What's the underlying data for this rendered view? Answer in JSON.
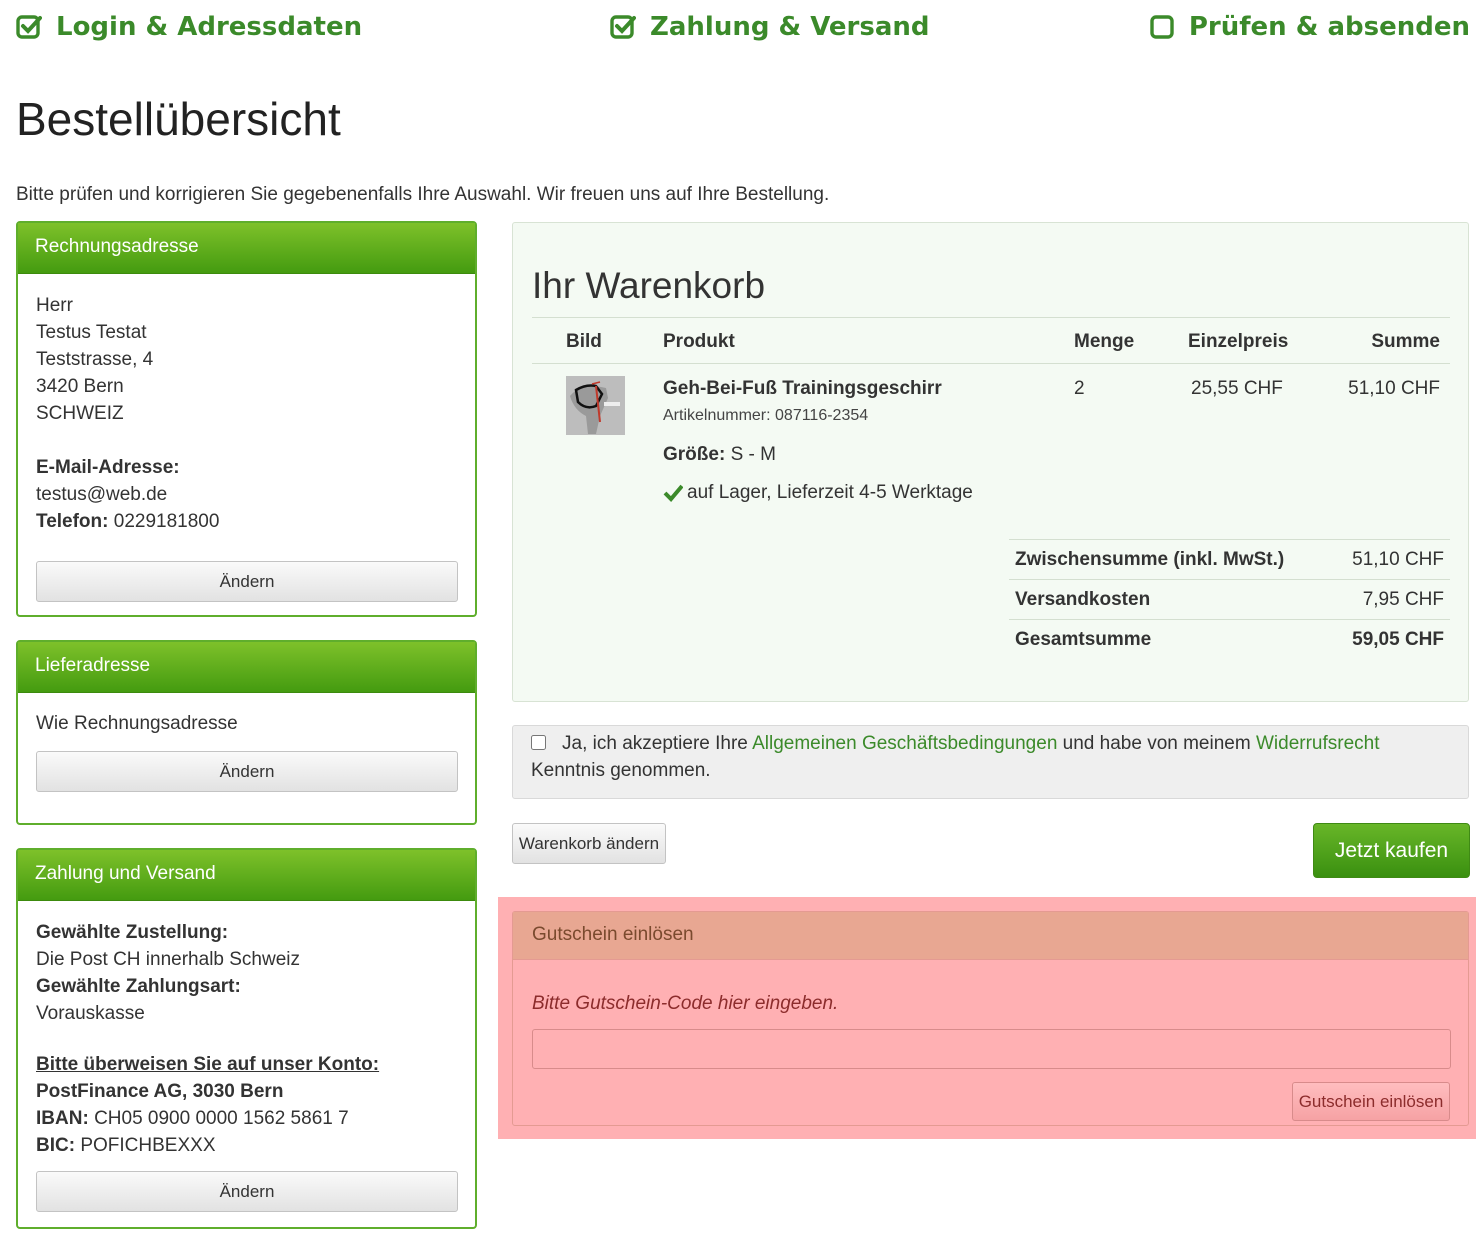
{
  "steps": [
    {
      "label": "Login & Adressdaten",
      "state": "done"
    },
    {
      "label": "Zahlung & Versand",
      "state": "done"
    },
    {
      "label": "Prüfen & absenden",
      "state": "open"
    }
  ],
  "page_title": "Bestellübersicht",
  "intro": "Bitte prüfen und korrigieren Sie gegebenenfalls Ihre Auswahl. Wir freuen uns auf Ihre Bestellung.",
  "billing": {
    "title": "Rechnungsadresse",
    "salutation": "Herr",
    "name": "Testus Testat",
    "street": "Teststrasse, 4",
    "city": "3420 Bern",
    "country": "SCHWEIZ",
    "email_label": "E-Mail-Adresse:",
    "email": "testus@web.de",
    "phone_label": "Telefon:",
    "phone": "0229181800",
    "change_label": "Ändern"
  },
  "shipping": {
    "title": "Lieferadresse",
    "text": "Wie Rechnungsadresse",
    "change_label": "Ändern"
  },
  "payment": {
    "title": "Zahlung und Versand",
    "delivery_label": "Gewählte Zustellung:",
    "delivery": "Die Post CH innerhalb Schweiz",
    "method_label": "Gewählte Zahlungsart:",
    "method": "Vorauskasse",
    "transfer_label": "Bitte überweisen Sie auf unser Konto:",
    "bank": "PostFinance AG, 3030 Bern",
    "iban_label": "IBAN:",
    "iban": "CH05 0900 0000 1562 5861 7",
    "bic_label": "BIC:",
    "bic": "POFICHBEXXX",
    "change_label": "Ändern"
  },
  "cart": {
    "title": "Ihr Warenkorb",
    "headers": {
      "image": "Bild",
      "product": "Produkt",
      "qty": "Menge",
      "unit_price": "Einzelpreis",
      "sum": "Summe"
    },
    "item": {
      "name": "Geh-Bei-Fuß Trainingsgeschirr",
      "article": "Artikelnummer: 087116-2354",
      "size_label": "Größe:",
      "size": "S - M",
      "stock": "auf Lager, Lieferzeit 4-5 Werktage",
      "qty": "2",
      "unit_price": "25,55 CHF",
      "sum": "51,10 CHF"
    },
    "totals": [
      {
        "label": "Zwischensumme (inkl. MwSt.)",
        "value": "51,10 CHF"
      },
      {
        "label": "Versandkosten",
        "value": "7,95 CHF"
      },
      {
        "label": "Gesamtsumme",
        "value": "59,05 CHF"
      }
    ]
  },
  "agb": {
    "text_1": "Ja, ich akzeptiere Ihre ",
    "link_1": "Allgemeinen Geschäftsbedingungen",
    "text_2": " und habe von meinem ",
    "link_2": "Widerrufsrecht",
    "text_3": " Kenntnis genommen.",
    "checked": false
  },
  "buttons": {
    "edit_cart": "Warenkorb ändern",
    "buy": "Jetzt kaufen"
  },
  "voucher": {
    "title": "Gutschein einlösen",
    "hint": "Bitte Gutschein-Code hier eingeben.",
    "input_value": "",
    "submit_label": "Gutschein einlösen"
  },
  "colors": {
    "brand_green": "#449b10",
    "link_green": "#3b8a2a",
    "highlight_red": "#ffb0b3"
  }
}
